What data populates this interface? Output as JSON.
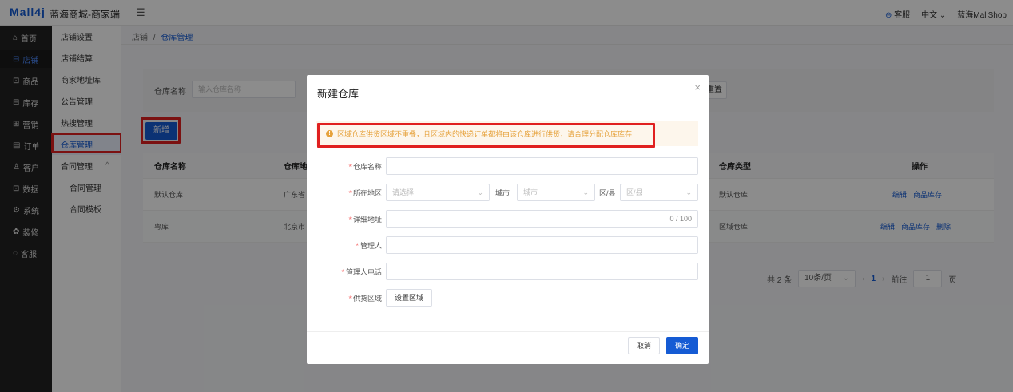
{
  "header": {
    "logo": "Mall4j",
    "app_name": "蓝海商城-商家端",
    "menu_icon": "menu-fold-icon",
    "service": "客服",
    "language": "中文",
    "shop_name": "蓝海MallShop"
  },
  "sidebar_main": [
    {
      "icon": "⌂",
      "label": "首页"
    },
    {
      "icon": "⊟",
      "label": "店铺"
    },
    {
      "icon": "⊡",
      "label": "商品"
    },
    {
      "icon": "⊟",
      "label": "库存"
    },
    {
      "icon": "⊞",
      "label": "营销"
    },
    {
      "icon": "▤",
      "label": "订单"
    },
    {
      "icon": "♙",
      "label": "客户"
    },
    {
      "icon": "⊡",
      "label": "数据"
    },
    {
      "icon": "⚙",
      "label": "系统"
    },
    {
      "icon": "✿",
      "label": "装修"
    },
    {
      "icon": "◌",
      "label": "客服"
    }
  ],
  "sidebar_sub": [
    {
      "label": "店铺设置"
    },
    {
      "label": "店铺结算"
    },
    {
      "label": "商家地址库"
    },
    {
      "label": "公告管理"
    },
    {
      "label": "热搜管理"
    },
    {
      "label": "仓库管理"
    },
    {
      "label": "合同管理"
    },
    {
      "label": "合同管理"
    },
    {
      "label": "合同模板"
    }
  ],
  "breadcrumb": {
    "root": "店铺",
    "sep": "/",
    "current": "仓库管理"
  },
  "search": {
    "label": "仓库名称",
    "placeholder": "输入仓库名称",
    "reset": "重置"
  },
  "add_button": "新增",
  "table": {
    "headers": [
      "仓库名称",
      "仓库地址",
      "仓库类型",
      "操作"
    ],
    "rows": [
      {
        "name": "默认仓库",
        "address": "广东省",
        "type": "默认仓库",
        "actions": [
          "编辑",
          "商品库存"
        ]
      },
      {
        "name": "粤库",
        "address": "北京市",
        "type": "区域仓库",
        "actions": [
          "编辑",
          "商品库存",
          "删除"
        ]
      }
    ]
  },
  "pagination": {
    "total": "共 2 条",
    "page_size": "10条/页",
    "current_page": "1",
    "goto_prefix": "前往",
    "goto_value": "1",
    "goto_suffix": "页"
  },
  "dialog": {
    "title": "新建仓库",
    "close": "×",
    "alert": "区域仓库供货区域不重叠，且区域内的快递订单都将由该仓库进行供货，请合理分配仓库库存",
    "fields": {
      "name_label": "仓库名称",
      "region_label": "所在地区",
      "province_placeholder": "请选择",
      "city_label": "城市",
      "city_placeholder": "城市",
      "district_label": "区/县",
      "district_placeholder": "区/县",
      "address_label": "详细地址",
      "address_counter": "0 / 100",
      "manager_label": "管理人",
      "phone_label": "管理人电话",
      "area_label": "供货区域",
      "area_button": "设置区域"
    },
    "cancel": "取消",
    "confirm": "确定"
  },
  "colors": {
    "primary": "#155bd4",
    "warning": "#e6a23c",
    "highlight": "#e02020"
  }
}
